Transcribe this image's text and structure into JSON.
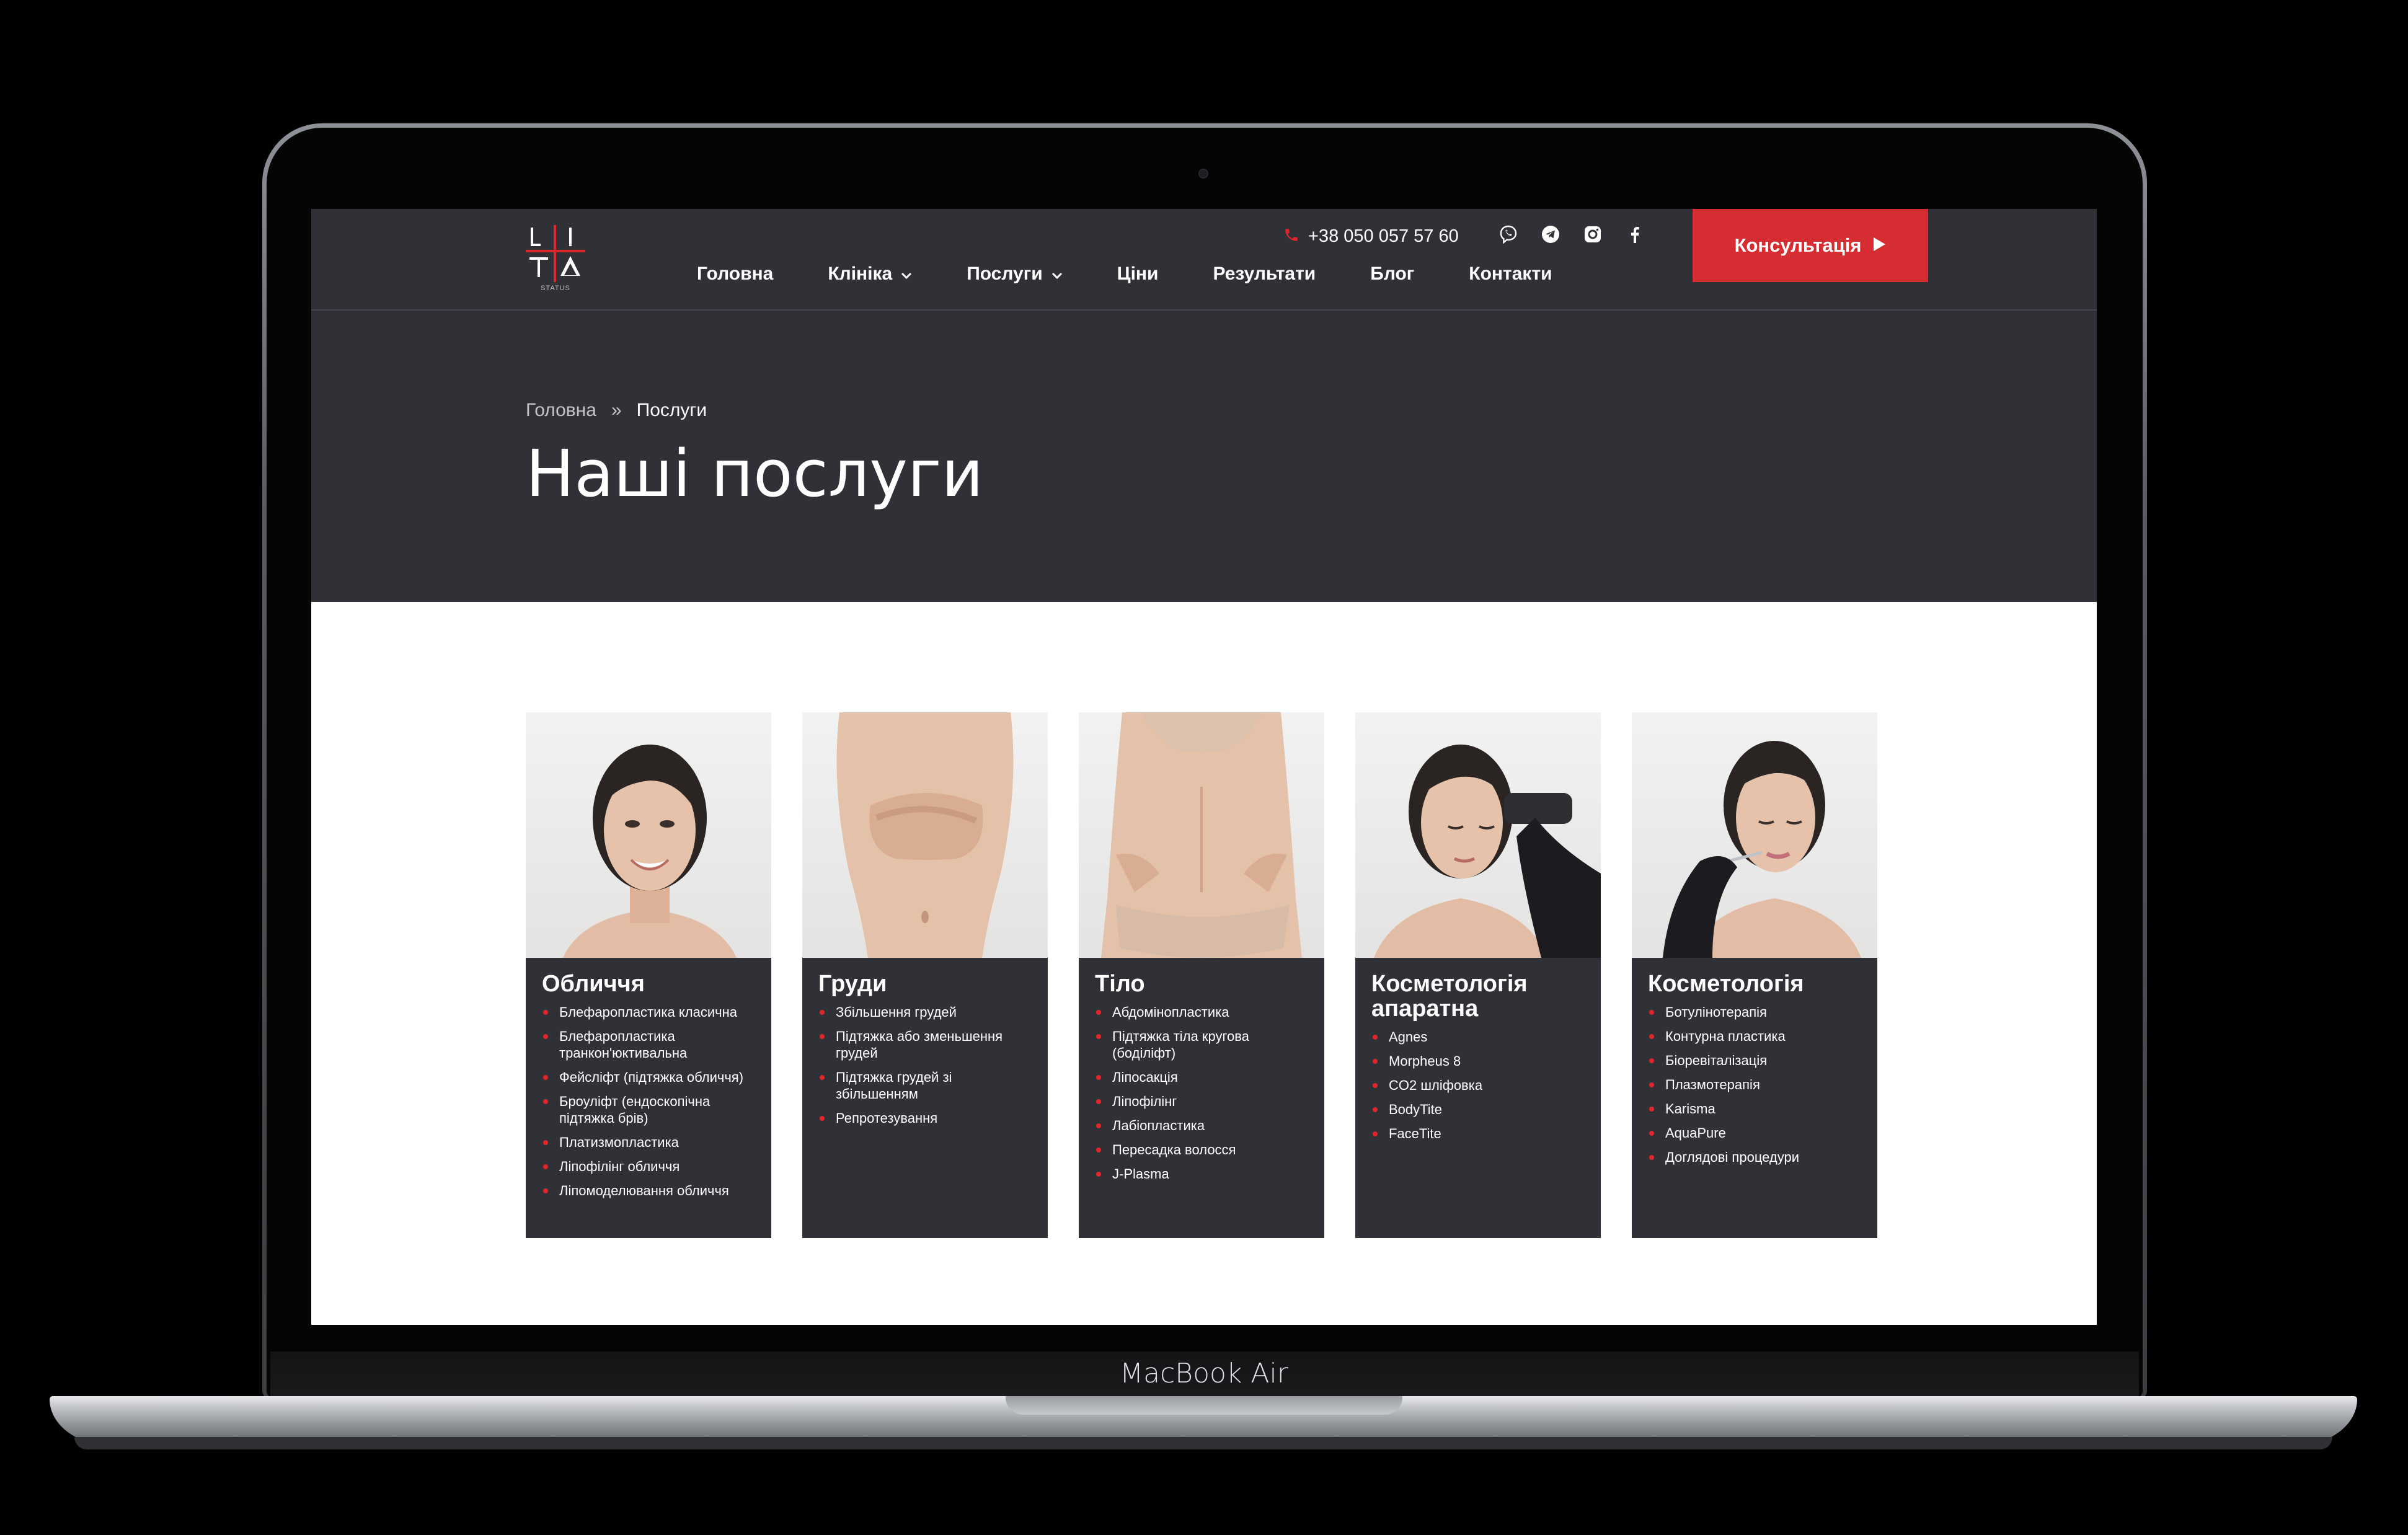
{
  "device": {
    "model_label": "MacBook Air"
  },
  "header": {
    "logo_sub": "STATUS",
    "phone": "+38 050 057 57 60",
    "socials": [
      "viber-icon",
      "telegram-icon",
      "instagram-icon",
      "facebook-icon"
    ],
    "nav": [
      {
        "label": "Головна",
        "dropdown": false
      },
      {
        "label": "Клініка",
        "dropdown": true
      },
      {
        "label": "Послуги",
        "dropdown": true
      },
      {
        "label": "Ціни",
        "dropdown": false
      },
      {
        "label": "Результати",
        "dropdown": false
      },
      {
        "label": "Блог",
        "dropdown": false
      },
      {
        "label": "Контакти",
        "dropdown": false
      }
    ],
    "cta_label": "Консультація"
  },
  "hero": {
    "breadcrumb": {
      "home": "Головна",
      "separator": "»",
      "current": "Послуги"
    },
    "title": "Наші послуги"
  },
  "colors": {
    "dark": "#303037",
    "accent": "#d62d32",
    "bullet": "#e0262b"
  },
  "cards": [
    {
      "title": "Обличчя",
      "items": [
        "Блефаропластика класична",
        "Блефаропластика транкон'юктивальна",
        "Фейсліфт (підтяжка обличчя)",
        "Броуліфт (ендоскопічна підтяжка брів)",
        "Платизмопластика",
        "Ліпофілінг обличчя",
        "Ліпомоделювання обличчя"
      ]
    },
    {
      "title": "Груди",
      "items": [
        "Збільшення грудей",
        "Підтяжка або зменьшення грудей",
        "Підтяжка грудей зі збільшенням",
        "Репротезування"
      ]
    },
    {
      "title": "Тіло",
      "items": [
        "Абдомінопластика",
        "Підтяжка тіла кругова (боділіфт)",
        "Ліпосакція",
        "Ліпофілінг",
        "Лабіопластика",
        "Пересадка волосся",
        "J-Plasma"
      ]
    },
    {
      "title": "Косметологія апаратна",
      "items": [
        "Agnes",
        "Morpheus 8",
        "CO2 шліфовка",
        "BodyTite",
        "FaceTite"
      ]
    },
    {
      "title": "Косметологія",
      "items": [
        "Ботулінотерапія",
        "Контурна пластика",
        "Біоревіталізація",
        "Плазмотерапія",
        "Karisma",
        "AquaPure",
        "Доглядові процедури"
      ]
    }
  ]
}
